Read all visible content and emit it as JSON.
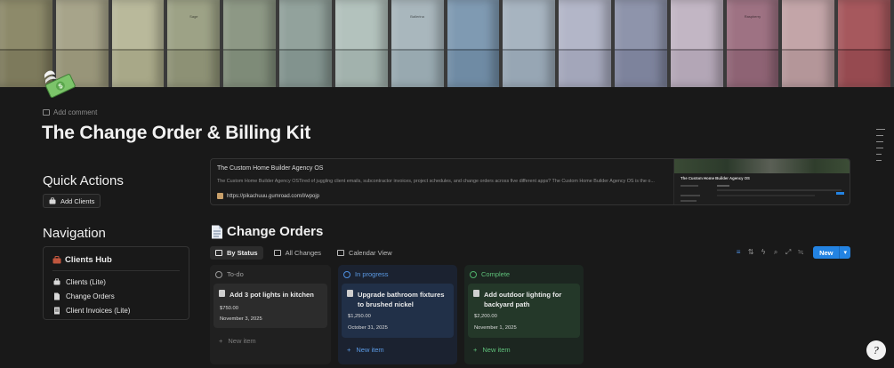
{
  "cover": {
    "swatches": [
      {
        "top": "#8d8a6a",
        "bottom": "#7d7a5c",
        "label": ""
      },
      {
        "top": "#a7a48a",
        "bottom": "#989579",
        "label": ""
      },
      {
        "top": "#b9b99b",
        "bottom": "#a8a888",
        "label": ""
      },
      {
        "top": "#9da286",
        "bottom": "#8d9175",
        "label": "Sage"
      },
      {
        "top": "#8d9885",
        "bottom": "#7e8b78",
        "label": ""
      },
      {
        "top": "#92a29c",
        "bottom": "#82938e",
        "label": ""
      },
      {
        "top": "#b3c2bd",
        "bottom": "#a2b2ad",
        "label": ""
      },
      {
        "top": "#a9b7bd",
        "bottom": "#98a9b0",
        "label": "Ballerina"
      },
      {
        "top": "#7f9ab2",
        "bottom": "#6f8ba4",
        "label": ""
      },
      {
        "top": "#a7b4c0",
        "bottom": "#97a6b4",
        "label": ""
      },
      {
        "top": "#b3b6c8",
        "bottom": "#a3a6ba",
        "label": ""
      },
      {
        "top": "#8e94ab",
        "bottom": "#7d839c",
        "label": ""
      },
      {
        "top": "#c2b6c4",
        "bottom": "#b3a6b6",
        "label": ""
      },
      {
        "top": "#9e7283",
        "bottom": "#8e6374",
        "label": "Raspberry"
      },
      {
        "top": "#c3a5a8",
        "bottom": "#b49699",
        "label": ""
      },
      {
        "top": "#a6585d",
        "bottom": "#964a50",
        "label": ""
      }
    ]
  },
  "page": {
    "add_comment": "Add comment",
    "title": "The Change Order & Billing Kit"
  },
  "quick_actions": {
    "heading": "Quick Actions",
    "add_clients": "Add Clients"
  },
  "navigation": {
    "heading": "Navigation",
    "hub_title": "Clients Hub",
    "items": [
      {
        "label": "Clients (Lite)",
        "icon": "building-icon"
      },
      {
        "label": "Change Orders",
        "icon": "document-icon"
      },
      {
        "label": "Client Invoices (Lite)",
        "icon": "receipt-icon"
      }
    ]
  },
  "bookmark": {
    "title": "The Custom Home Builder Agency OS",
    "description": "The Custom Home Builder Agency OSTired of juggling client emails, subcontractor invoices, project schedules, and change orders across five different apps? The Custom Home Builder Agency OS is the o...",
    "url": "https://pikachuuu.gumroad.com/l/wpojp",
    "thumb_title": "The Custom Home Builder Agency OS"
  },
  "change_orders": {
    "heading": "Change Orders",
    "tabs": [
      {
        "label": "By Status",
        "active": true
      },
      {
        "label": "All Changes",
        "active": false
      },
      {
        "label": "Calendar View",
        "active": false
      }
    ],
    "new_label": "New",
    "columns": [
      {
        "status": "To-do",
        "status_color": "#9b9b9b",
        "new_item": "New item",
        "card": {
          "title": "Add 3 pot lights in kitchen",
          "amount": "$750.00",
          "date": "November 3, 2025"
        }
      },
      {
        "status": "In progress",
        "status_color": "#4d8fe0",
        "new_item": "New item",
        "card": {
          "title": "Upgrade bathroom fixtures to brushed nickel",
          "amount": "$1,250.00",
          "date": "October 31, 2025"
        }
      },
      {
        "status": "Complete",
        "status_color": "#4fb26b",
        "new_item": "New item",
        "card": {
          "title": "Add outdoor lighting for backyard path",
          "amount": "$2,200.00",
          "date": "November 1, 2025"
        }
      }
    ]
  },
  "help": {
    "glyph": "?"
  }
}
